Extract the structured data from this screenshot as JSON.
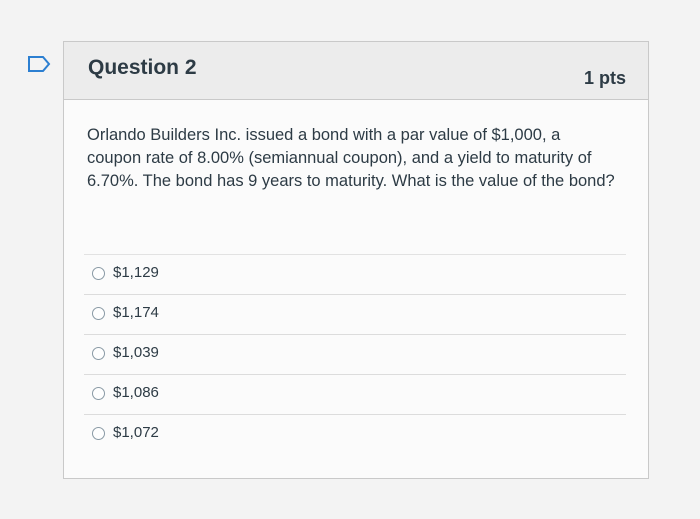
{
  "question": {
    "title": "Question 2",
    "points": "1 pts",
    "text": "Orlando Builders Inc. issued a bond with a par value of $1,000, a coupon rate of 8.00% (semiannual coupon), and a yield to maturity of 6.70%. The bond has 9 years to maturity. What is the value of the bond?"
  },
  "answers": [
    {
      "label": "$1,129"
    },
    {
      "label": "$1,174"
    },
    {
      "label": "$1,039"
    },
    {
      "label": "$1,086"
    },
    {
      "label": "$1,072"
    }
  ],
  "icons": {
    "flag": "flag-icon"
  },
  "colors": {
    "text": "#2d3b45",
    "header_bg": "#ececec",
    "border": "#c9c9c9"
  }
}
